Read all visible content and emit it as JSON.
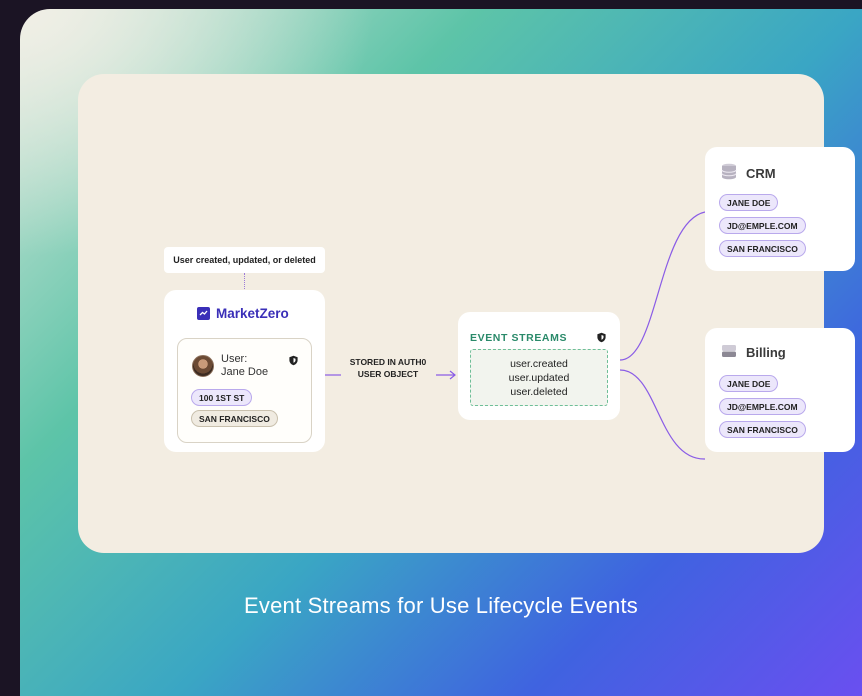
{
  "diagram": {
    "trigger_label": "User created, updated, or deleted",
    "source": {
      "brand": "MarketZero",
      "user_label": "User:",
      "user_name": "Jane Doe",
      "address": "100 1ST ST",
      "city": "SAN FRANCISCO"
    },
    "connector_label_line1": "STORED IN AUTH0",
    "connector_label_line2": "USER OBJECT",
    "event_streams": {
      "title": "EVENT STREAMS",
      "events": [
        "user.created",
        "user.updated",
        "user.deleted"
      ]
    },
    "destinations": [
      {
        "name": "CRM",
        "icon": "database-icon",
        "fields": [
          "JANE DOE",
          "JD@EMPLE.COM",
          "SAN FRANCISCO"
        ]
      },
      {
        "name": "Billing",
        "icon": "server-icon",
        "fields": [
          "JANE DOE",
          "JD@EMPLE.COM",
          "SAN FRANCISCO"
        ]
      }
    ]
  },
  "caption": "Event Streams for Use Lifecycle Events",
  "colors": {
    "brand": "#3a2fb8",
    "connector": "#8a5ce6",
    "event_title": "#2a8a6a",
    "panel": "#f3ede2"
  }
}
